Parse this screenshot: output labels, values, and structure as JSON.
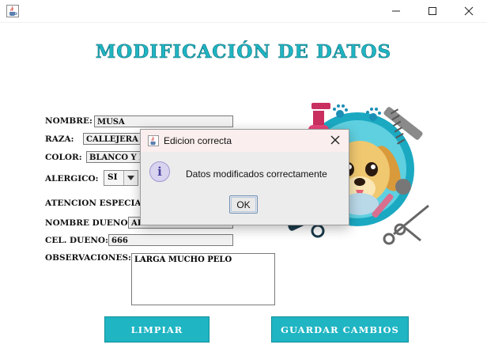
{
  "window": {
    "title_icon": "java-cup-icon",
    "controls": [
      "minimize-icon",
      "maximize-icon",
      "close-icon"
    ]
  },
  "heading": "MODIFICACIÓN DE DATOS",
  "form": {
    "nombre_label": "NOMBRE:",
    "nombre_value": "MUSA",
    "raza_label": "RAZA:",
    "raza_value": "CALLEJERA",
    "color_label": "COLOR:",
    "color_value": "BLANCO Y N",
    "alergico_label": "ALERGICO:",
    "alergico_value": "SI",
    "atencion_label": "ATENCION ESPECIAL:",
    "nombre_dueno_label": "NOMBRE DUENO:",
    "nombre_dueno_value": "ADA",
    "cel_dueno_label": "CEL. DUENO:",
    "cel_dueno_value": "666",
    "observaciones_label": "OBSERVACIONES:",
    "observaciones_value": "LARGA MUCHO PELO"
  },
  "buttons": {
    "limpiar": "LIMPIAR",
    "guardar": "GUARDAR CAMBIOS"
  },
  "dialog": {
    "title": "Edicion correcta",
    "message": "Datos modificados correctamente",
    "ok": "OK"
  },
  "colors": {
    "accent": "#1fb5c3",
    "dialog_titlebar": "#fbeeee"
  }
}
